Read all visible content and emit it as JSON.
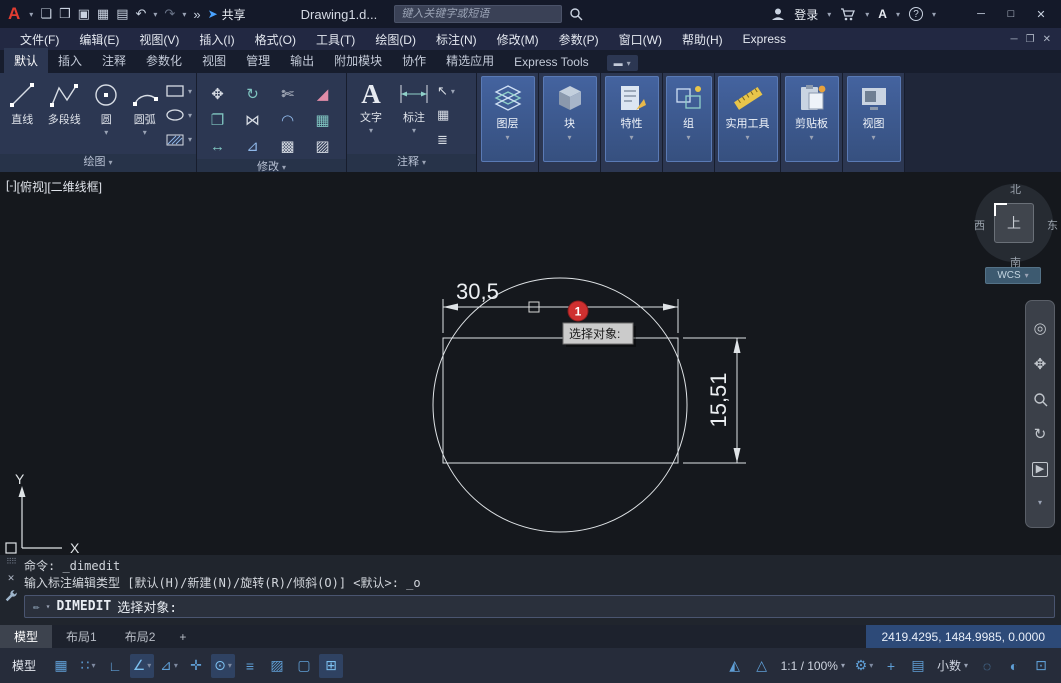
{
  "titlebar": {
    "logo_letter": "A",
    "doc_title": "Drawing1.d...",
    "search_placeholder": "键入关键字或短语",
    "share_label": "共享",
    "login_label": "登录",
    "help_mark": "?"
  },
  "menubar": {
    "items": [
      "文件(F)",
      "编辑(E)",
      "视图(V)",
      "插入(I)",
      "格式(O)",
      "工具(T)",
      "绘图(D)",
      "标注(N)",
      "修改(M)",
      "参数(P)",
      "窗口(W)",
      "帮助(H)",
      "Express"
    ]
  },
  "ribbon": {
    "tabs": [
      "默认",
      "插入",
      "注释",
      "参数化",
      "视图",
      "管理",
      "输出",
      "附加模块",
      "协作",
      "精选应用",
      "Express Tools"
    ],
    "draw": {
      "title": "绘图",
      "tools": [
        "直线",
        "多段线",
        "圆",
        "圆弧"
      ]
    },
    "modify": {
      "title": "修改"
    },
    "annotate": {
      "title": "注释",
      "text_label": "文字",
      "dim_label": "标注"
    },
    "collapsed_panels": [
      "图层",
      "块",
      "特性",
      "组",
      "实用工具",
      "剪贴板",
      "视图"
    ]
  },
  "canvas": {
    "viewport_controls": [
      "[-]",
      "[俯视]",
      "[二维线框]"
    ],
    "viewcube": {
      "north": "北",
      "south": "南",
      "east": "东",
      "west": "西",
      "top": "上"
    },
    "wcs_label": "WCS",
    "ucs": {
      "x": "X",
      "y": "Y"
    },
    "dims": {
      "horizontal": "30,5",
      "vertical": "15,51"
    },
    "badge": "1",
    "tooltip": "选择对象:"
  },
  "command": {
    "history": [
      "命令: _dimedit",
      "输入标注编辑类型 [默认(H)/新建(N)/旋转(R)/倾斜(O)] <默认>: _o"
    ],
    "active_command": "DIMEDIT",
    "prompt": "选择对象:"
  },
  "layout_bar": {
    "tabs": [
      "模型",
      "布局1",
      "布局2"
    ],
    "add": "+",
    "coordinates": "2419.4295, 1484.9985, 0.0000"
  },
  "statusbar": {
    "model_label": "模型",
    "scale_label": "1:1 / 100%",
    "units_label": "小数"
  },
  "icons": {
    "dropdown": "▾",
    "qat_new": "❏",
    "qat_open": "❒",
    "qat_save": "▣",
    "qat_saveas": "▦",
    "qat_print": "▤",
    "qat_undo": "↶",
    "qat_redo": "↷",
    "qat_overflow": "»",
    "share_arrow": "➤",
    "win_min": "─",
    "win_max": "□",
    "win_close": "✕",
    "win_restore": "❐",
    "ribbon_toggle": "▬",
    "mod_move": "✥",
    "mod_rotate": "↻",
    "mod_trim": "✄",
    "mod_erase": "◢",
    "mod_copy": "❐",
    "mod_mirror": "⋈",
    "mod_fillet": "◠",
    "mod_array": "▦",
    "mod_stretch": "↔",
    "mod_scale": "⊿",
    "mod_array2": "▩",
    "mod_explode": "▨",
    "ann_leader": "↖",
    "ann_table": "▦",
    "ann_tolerance": "≣",
    "nav_wheel": "◎",
    "nav_pan": "✥",
    "nav_orbit": "↻",
    "nav_motion": "▶",
    "cmd_grip": "⠿⠿",
    "cmd_close": "✕",
    "cmd_pencil": "✏",
    "sb_grid": "▦",
    "sb_snap": "∷",
    "sb_ortho": "∟",
    "sb_polar": "∠",
    "sb_iso": "⊿",
    "sb_otrack": "✛",
    "sb_osnap": "⊙",
    "sb_lwt": "≡",
    "sb_transparency": "▨",
    "sb_cycle": "▢",
    "sb_dyn": "⊞",
    "sb_annvis": "◭",
    "sb_annauto": "△",
    "sb_gear": "⚙",
    "sb_plus": "+",
    "sb_qprop": "▤",
    "sb_isolate": "◌",
    "sb_graphics": "◐",
    "sb_clean": "⊡"
  }
}
